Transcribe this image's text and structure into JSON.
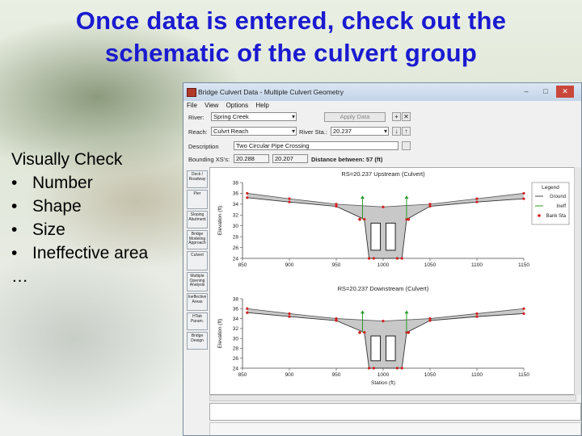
{
  "slide": {
    "title_line1": "Once data is entered, check out the",
    "title_line2": "schematic of the culvert group",
    "bullets_heading": "Visually Check",
    "bullets": [
      "Number",
      "Shape",
      "Size",
      "Ineffective area"
    ],
    "ellipsis": "…",
    "bullet_glyph": "•"
  },
  "window": {
    "title": "Bridge Culvert Data - Multiple Culvert Geometry",
    "min_glyph": "–",
    "max_glyph": "□",
    "close_glyph": "✕",
    "menu": [
      "File",
      "View",
      "Options",
      "Help"
    ],
    "river_label": "River:",
    "river_value": "Spring Creek",
    "reach_label": "Reach:",
    "reach_value": "Culvrt Reach",
    "river_sta_label": "River Sta.:",
    "river_sta_value": "20.237",
    "apply_label": "Apply Data",
    "plus_glyph": "+",
    "delete_glyph": "✕",
    "down_glyph": "↓",
    "up_glyph": "↑",
    "description_label": "Description",
    "description_value": "Two Circular Pipe Crossing",
    "bounding_label": "Bounding XS's:",
    "bounding_left": "20.288",
    "bounding_right": "20.207",
    "distance_label": "Distance between: 57 (ft)",
    "tools": [
      "Deck / Roadway",
      "Pier",
      "Sloping Abutment",
      "Bridge Modeling Approach",
      "Culvert",
      "Multiple Opening Analysis",
      "Ineffective Areas",
      "HTab Param.",
      "Bridge Design"
    ]
  },
  "chart_data": [
    {
      "type": "line",
      "title": "RS=20.237 Upstream (Culvert)",
      "ylabel": "Elevation (ft)",
      "xlabel": "",
      "x_ticks": [
        850,
        900,
        950,
        1000,
        1050,
        1100,
        1150
      ],
      "y_ticks": [
        24,
        26,
        28,
        30,
        32,
        34,
        36,
        38
      ],
      "xlim": [
        850,
        1150
      ],
      "ylim": [
        24,
        38
      ],
      "series": [
        {
          "name": "Ground",
          "x": [
            855,
            900,
            950,
            980,
            985,
            990,
            1015,
            1020,
            1025,
            1050,
            1100,
            1150
          ],
          "y": [
            35.2,
            34.4,
            33.6,
            31.2,
            24.0,
            24.0,
            24.0,
            24.0,
            31.2,
            33.6,
            34.4,
            35.0
          ]
        },
        {
          "name": "Deck",
          "x": [
            855,
            900,
            950,
            1000,
            1050,
            1100,
            1150
          ],
          "y": [
            36.0,
            35.0,
            34.0,
            33.5,
            34.0,
            35.0,
            36.0
          ]
        },
        {
          "name": "Ineff",
          "x": [
            978,
            1025
          ],
          "y": [
            35.0,
            35.0
          ]
        },
        {
          "name": "Bank Sta",
          "x": [
            975,
            1027
          ],
          "y": [
            31.2,
            31.2
          ]
        }
      ],
      "legend": [
        "Legend",
        "Ground",
        "Ineff",
        "Bank Sta"
      ],
      "legend_position": "right",
      "grid": false
    },
    {
      "type": "line",
      "title": "RS=20.237 Downstream (Culvert)",
      "ylabel": "Elevation (ft)",
      "xlabel": "Station (ft)",
      "x_ticks": [
        850,
        900,
        950,
        1000,
        1050,
        1100,
        1150
      ],
      "y_ticks": [
        24,
        26,
        28,
        30,
        32,
        34,
        36,
        38
      ],
      "xlim": [
        850,
        1150
      ],
      "ylim": [
        24,
        38
      ],
      "series": [
        {
          "name": "Ground",
          "x": [
            855,
            900,
            950,
            980,
            985,
            990,
            1015,
            1020,
            1025,
            1050,
            1100,
            1150
          ],
          "y": [
            35.2,
            34.4,
            33.6,
            31.2,
            24.0,
            24.0,
            24.0,
            24.0,
            31.2,
            33.6,
            34.4,
            35.0
          ]
        },
        {
          "name": "Deck",
          "x": [
            855,
            900,
            950,
            1000,
            1050,
            1100,
            1150
          ],
          "y": [
            36.0,
            35.0,
            34.0,
            33.5,
            34.0,
            35.0,
            36.0
          ]
        },
        {
          "name": "Ineff",
          "x": [
            978,
            1025
          ],
          "y": [
            35.0,
            35.0
          ]
        },
        {
          "name": "Bank Sta",
          "x": [
            975,
            1027
          ],
          "y": [
            31.2,
            31.2
          ]
        }
      ],
      "grid": false
    }
  ],
  "colors": {
    "title": "#1a1ad0",
    "fill": "#c8c8c8",
    "ground": "#d21e1e",
    "ineff": "#2a9a2a",
    "bank": "#d21e1e",
    "culvert": "#222222"
  }
}
